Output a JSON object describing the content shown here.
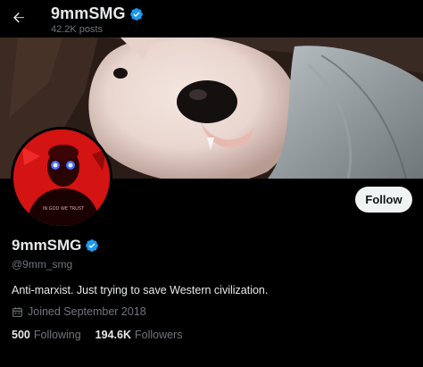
{
  "header": {
    "display_name": "9mmSMG",
    "post_count": "42.2K posts"
  },
  "profile": {
    "display_name": "9mmSMG",
    "handle": "@9mm_smg",
    "bio": "Anti-marxist. Just trying to save Western civilization.",
    "joined": "Joined September 2018",
    "following_count": "500",
    "following_label": "Following",
    "followers_count": "194.6K",
    "followers_label": "Followers",
    "avatar_shirt_text": "IN GOD WE TRUST"
  },
  "actions": {
    "follow_label": "Follow"
  },
  "colors": {
    "background": "#000000",
    "text_primary": "#e7e9ea",
    "text_secondary": "#71767b",
    "verified_blue": "#1d9bf0",
    "follow_bg": "#eff3f4",
    "avatar_red": "#d01010"
  }
}
